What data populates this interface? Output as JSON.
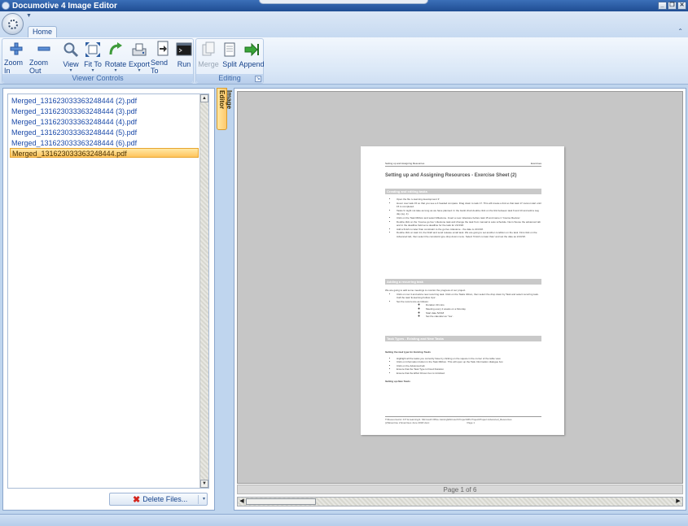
{
  "window": {
    "title": "Documotive 4 Image Editor",
    "controls": [
      "_",
      "❐",
      "✕"
    ]
  },
  "tabs": [
    {
      "label": "Home",
      "active": true
    }
  ],
  "ribbon": {
    "groups": [
      {
        "label": "Viewer Controls"
      },
      {
        "label": "Editing"
      }
    ],
    "buttons": {
      "zoom_in": "Zoom In",
      "zoom_out": "Zoom Out",
      "view": "View",
      "fit_to": "Fit To",
      "rotate": "Rotate",
      "export": "Export",
      "send_to": "Send To",
      "run": "Run",
      "merge": "Merge",
      "split": "Split",
      "append": "Append"
    }
  },
  "files": [
    {
      "name": "Merged_131623033363248444 (2).pdf",
      "selected": false
    },
    {
      "name": "Merged_131623033363248444 (3).pdf",
      "selected": false
    },
    {
      "name": "Merged_131623033363248444 (4).pdf",
      "selected": false
    },
    {
      "name": "Merged_131623033363248444 (5).pdf",
      "selected": false
    },
    {
      "name": "Merged_131623033363248444 (6).pdf",
      "selected": false
    },
    {
      "name": "Merged_131623033363248444.pdf",
      "selected": true
    }
  ],
  "delete_button": "Delete Files...",
  "side_tab": "Image Editor",
  "viewer": {
    "page_status": "Page 1 of 6"
  },
  "document": {
    "header_left": "Setting up and Assigning Resources",
    "header_right": "Exercises",
    "title": "Setting up and Assigning Resources - Exercise Sheet (2)",
    "section1": "Creating and editing tasks",
    "bullets1": [
      "Open the file 'e-learning development 3'",
      "Hover over task 15 so that you see a 4 headed compass. Drag down to task 17. This will create a link so that task 17 cannot start until 15 is completed.",
      "Tasks 9 might not take as long as we have planned. In the Gantt chart double click on the link between task 9 and 10 and add a Lag day (eg -1).",
      "Click on the Task Ribbon and select Milestone. Insert a new milestone before task 15 and name it 'Course Review'.",
      "Double click on the 'Course go live' milestone task and change the task from manual to auto schedule. Next choose the advanced tab and in the deadline field set a deadline for the task for 21/3/18.",
      "Add a finish no later than constraint to the go live milestone - the date is 21/3/18.",
      "Double click on task 14, the Draft and send release email task. We are going to set another condition on the task. First click on the Advanced tab, then select the constraint type drop down menu. Select 'Finish no later than' and set the date as 21/3/18."
    ],
    "section2": "Adding a recurring task",
    "para2": "We are going to add some meetings to monitor the progress of our project.",
    "bullets2": [
      "Click on row 4 and add a new recurring task. Click on the Tasks ribbon, then select the drop down by Task and select recurring task. Call the task 'E-learning Follow Ups'.",
      "Set the recurrence as follows:"
    ],
    "sub_bullets": [
      "Duration 30 mins",
      "Meeting every 2 weeks on a Monday",
      "Start date 5/2/18",
      "Set the calendar as 'Yes'."
    ],
    "section3": "Task Types - Existing and New Tasks",
    "italic1": "Setting the task type for Existing Tasks",
    "bullets3": [
      "Highlight all the tasks you currently have by clicking on the square in the corner of the table view.",
      "Click on Information button in the Task Ribbon. This will open up the Task Information dialogue box",
      "Click on the Advanced tab",
      "Ensure that the Task Type is Fixed Duration",
      "Ensure that the Effort Driven box is Unticked"
    ],
    "italic2": "Setting up New Tasks",
    "footer_line1": "T:\\Resources\\4. ICT E-learning\\1. Microsoft Office training\\Microsoft Project\\MS Project\\Project Advanced_Resources",
    "footer_line2": "(2)\\Exercise 2 Exercises June 2018.docx",
    "footer_page": "Page 1"
  }
}
